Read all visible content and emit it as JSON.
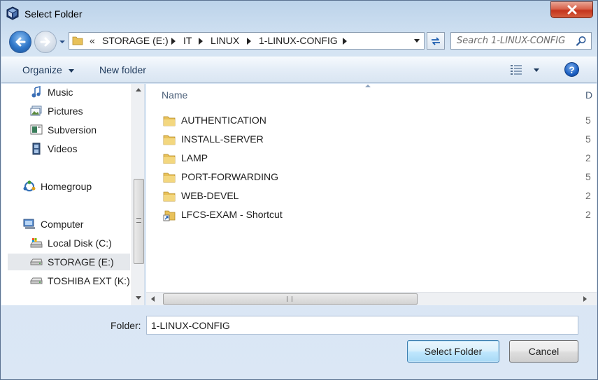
{
  "window": {
    "title": "Select Folder",
    "icon": "virtualbox-icon"
  },
  "address": {
    "overflow": "«",
    "crumbs": [
      "STORAGE (E:)",
      "IT",
      "LINUX",
      "1-LINUX-CONFIG"
    ]
  },
  "search": {
    "placeholder": "Search 1-LINUX-CONFIG"
  },
  "toolbar": {
    "organize_label": "Organize",
    "new_folder_label": "New folder",
    "help_label": "?"
  },
  "nav_pane": {
    "items": [
      {
        "label": "Music",
        "icon": "music-icon"
      },
      {
        "label": "Pictures",
        "icon": "pictures-icon"
      },
      {
        "label": "Subversion",
        "icon": "subversion-icon"
      },
      {
        "label": "Videos",
        "icon": "videos-icon"
      },
      {
        "label": "Homegroup",
        "icon": "homegroup-icon"
      },
      {
        "label": "Computer",
        "icon": "computer-icon"
      },
      {
        "label": "Local Disk (C:)",
        "icon": "local-disk-icon"
      },
      {
        "label": "STORAGE (E:)",
        "icon": "drive-icon",
        "selected": true
      },
      {
        "label": "TOSHIBA EXT (K:)",
        "icon": "drive-icon"
      }
    ]
  },
  "file_list": {
    "columns": {
      "name": "Name",
      "date": "D"
    },
    "rows": [
      {
        "name": "AUTHENTICATION",
        "date": "5",
        "icon": "folder-icon"
      },
      {
        "name": "INSTALL-SERVER",
        "date": "5",
        "icon": "folder-icon"
      },
      {
        "name": "LAMP",
        "date": "2",
        "icon": "folder-icon"
      },
      {
        "name": "PORT-FORWARDING",
        "date": "5",
        "icon": "folder-icon"
      },
      {
        "name": "WEB-DEVEL",
        "date": "2",
        "icon": "folder-icon"
      },
      {
        "name": "LFCS-EXAM - Shortcut",
        "date": "2",
        "icon": "shortcut-icon"
      }
    ]
  },
  "footer": {
    "folder_label": "Folder:",
    "folder_value": "1-LINUX-CONFIG",
    "select_label": "Select Folder",
    "cancel_label": "Cancel"
  },
  "colors": {
    "accent": "#3c7fb1",
    "close": "#c3341c",
    "folder": "#e8c15a"
  }
}
